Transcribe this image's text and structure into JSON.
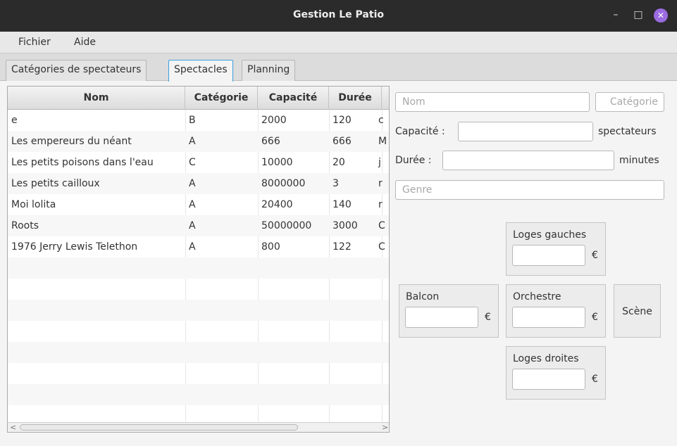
{
  "window": {
    "title": "Gestion Le Patio",
    "minimize_glyph": "–",
    "maximize_glyph": "□",
    "close_glyph": "✕"
  },
  "menu": [
    "Fichier",
    "Aide"
  ],
  "tabs": [
    {
      "label": "Catégories de spectateurs"
    },
    {
      "label": "Spectacles",
      "active": true
    },
    {
      "label": "Planning"
    }
  ],
  "table": {
    "columns": [
      "Nom",
      "Catégorie",
      "Capacité",
      "Durée"
    ],
    "rows": [
      {
        "nom": "e",
        "categorie": "B",
        "capacite": "2000",
        "duree": "120",
        "extra": "c"
      },
      {
        "nom": "Les empereurs du néant",
        "categorie": "A",
        "capacite": "666",
        "duree": "666",
        "extra": "M"
      },
      {
        "nom": "Les petits poisons dans l'eau",
        "categorie": "C",
        "capacite": "10000",
        "duree": "20",
        "extra": "j"
      },
      {
        "nom": "Les petits cailloux",
        "categorie": "A",
        "capacite": "8000000",
        "duree": "3",
        "extra": "r"
      },
      {
        "nom": "Moi lolita",
        "categorie": "A",
        "capacite": "20400",
        "duree": "140",
        "extra": "r"
      },
      {
        "nom": "Roots",
        "categorie": "A",
        "capacite": "50000000",
        "duree": "3000",
        "extra": "C"
      },
      {
        "nom": "1976 Jerry Lewis Telethon",
        "categorie": "A",
        "capacite": "800",
        "duree": "122",
        "extra": "C"
      }
    ],
    "scroll_left": "<",
    "scroll_right": ">"
  },
  "form": {
    "nom_placeholder": "Nom",
    "categorie_placeholder": "Catégorie",
    "capacite_label": "Capacité :",
    "capacite_unit": "spectateurs",
    "duree_label": "Durée :",
    "duree_unit": "minutes",
    "genre_placeholder": "Genre"
  },
  "seating": {
    "loges_gauches": "Loges gauches",
    "balcon": "Balcon",
    "orchestre": "Orchestre",
    "loges_droites": "Loges droites",
    "scene": "Scène",
    "currency": "€"
  }
}
